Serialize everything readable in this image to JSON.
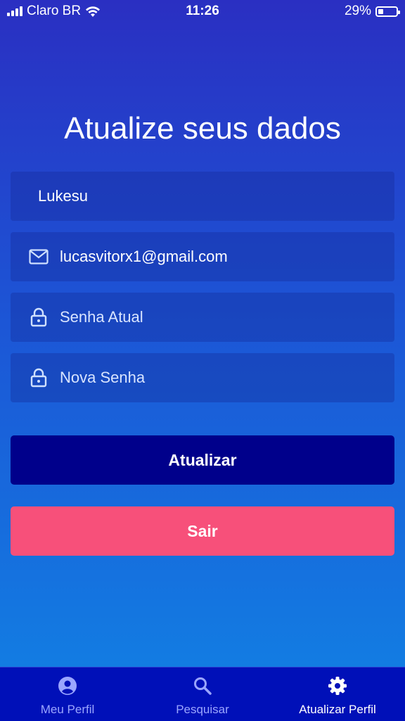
{
  "status_bar": {
    "carrier": "Claro BR",
    "time": "11:26",
    "battery_percent": "29%",
    "battery_level": 0.29
  },
  "form": {
    "title": "Atualize seus dados",
    "name_value": "Lukesu",
    "email_value": "lucasvitorx1@gmail.com",
    "current_password_placeholder": "Senha Atual",
    "new_password_placeholder": "Nova Senha",
    "icons": {
      "email": "mail-icon",
      "password": "lock-icon"
    }
  },
  "buttons": {
    "update_label": "Atualizar",
    "update_color": "#00008b",
    "logout_label": "Sair",
    "logout_color": "#f7507a"
  },
  "tab_bar": {
    "background": "#0010b8",
    "active_color": "#ffffff",
    "inactive_color": "#9aa6ff",
    "tabs": [
      {
        "label": "Meu Perfil",
        "icon": "user-circle-icon",
        "active": false
      },
      {
        "label": "Pesquisar",
        "icon": "search-icon",
        "active": false
      },
      {
        "label": "Atualizar Perfil",
        "icon": "gear-icon",
        "active": true
      }
    ]
  }
}
